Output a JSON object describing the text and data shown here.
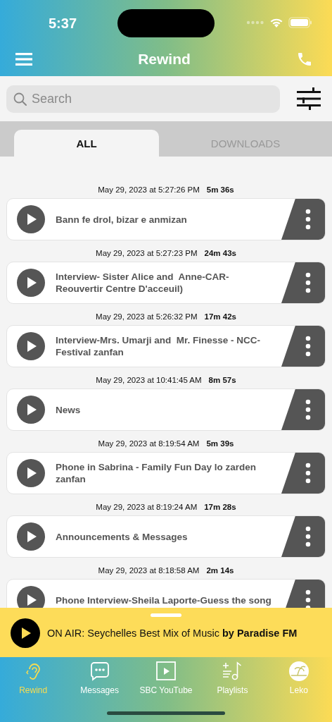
{
  "status_bar": {
    "time": "5:37"
  },
  "header": {
    "title": "Rewind"
  },
  "search": {
    "placeholder": "Search"
  },
  "tabs": [
    {
      "label": "ALL",
      "selected": true
    },
    {
      "label": "DOWNLOADS",
      "selected": false
    }
  ],
  "episodes": [
    {
      "date": "May 29, 2023 at 5:27:26 PM",
      "duration": "5m 36s",
      "title": "Bann fe drol, bizar e anmizan"
    },
    {
      "date": "May 29, 2023 at 5:27:23 PM",
      "duration": "24m 43s",
      "title": "Interview- Sister Alice and  Anne-CAR-Reouvertir Centre D'acceuil)"
    },
    {
      "date": "May 29, 2023 at 5:26:32 PM",
      "duration": "17m 42s",
      "title": "Interview-Mrs. Umarji and  Mr. Finesse - NCC-Festival zanfan"
    },
    {
      "date": "May 29, 2023 at 10:41:45 AM",
      "duration": "8m 57s",
      "title": "News"
    },
    {
      "date": "May 29, 2023 at 8:19:54 AM",
      "duration": "5m 39s",
      "title": "Phone in Sabrina - Family Fun Day lo zarden zanfan"
    },
    {
      "date": "May 29, 2023 at 8:19:24 AM",
      "duration": "17m 28s",
      "title": "Announcements & Messages"
    },
    {
      "date": "May 29, 2023 at 8:18:58 AM",
      "duration": "2m 14s",
      "title": "Phone Interview-Sheila Laporte-Guess the song"
    }
  ],
  "player": {
    "text": "ON AIR: Seychelles Best Mix of Music **by Paradise FM**"
  },
  "nav": [
    {
      "kind": "ear",
      "label": "Rewind",
      "selected": true
    },
    {
      "kind": "messages",
      "label": "Messages",
      "selected": false
    },
    {
      "kind": "video",
      "label": "SBC YouTube",
      "selected": false
    },
    {
      "kind": "playlist",
      "label": "Playlists",
      "selected": false
    },
    {
      "kind": "island",
      "label": "Leko",
      "selected": false
    }
  ]
}
